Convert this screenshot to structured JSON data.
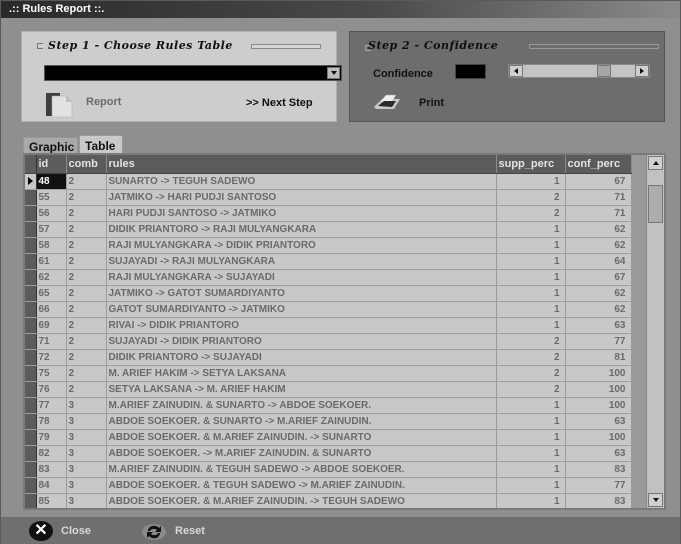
{
  "window": {
    "title": ".:: Rules Report ::."
  },
  "step1": {
    "heading": "Step 1 - Choose Rules Table",
    "dropdown_value": "",
    "report_label": "Report",
    "next_step_label": ">> Next Step"
  },
  "step2": {
    "heading": "Step 2 - Confidence",
    "confidence_label": "Confidence",
    "confidence_value": "",
    "slider_fraction": 0.75,
    "print_label": "Print"
  },
  "tabs": [
    {
      "label": "Graphic",
      "active": false
    },
    {
      "label": "Table",
      "active": true
    }
  ],
  "grid": {
    "columns": [
      "id",
      "comb",
      "rules",
      "supp_perc",
      "conf_perc"
    ],
    "selected_index": 0,
    "rows": [
      {
        "id": "48",
        "comb": "2",
        "rules": "SUNARTO -> TEGUH SADEWO",
        "supp_perc": "1",
        "conf_perc": "67"
      },
      {
        "id": "55",
        "comb": "2",
        "rules": "JATMIKO -> HARI PUDJI SANTOSO",
        "supp_perc": "2",
        "conf_perc": "71"
      },
      {
        "id": "56",
        "comb": "2",
        "rules": "HARI PUDJI SANTOSO -> JATMIKO",
        "supp_perc": "2",
        "conf_perc": "71"
      },
      {
        "id": "57",
        "comb": "2",
        "rules": "DIDIK PRIANTORO -> RAJI MULYANGKARA",
        "supp_perc": "1",
        "conf_perc": "62"
      },
      {
        "id": "58",
        "comb": "2",
        "rules": "RAJI MULYANGKARA -> DIDIK PRIANTORO",
        "supp_perc": "1",
        "conf_perc": "62"
      },
      {
        "id": "61",
        "comb": "2",
        "rules": "SUJAYADI -> RAJI MULYANGKARA",
        "supp_perc": "1",
        "conf_perc": "64"
      },
      {
        "id": "62",
        "comb": "2",
        "rules": "RAJI MULYANGKARA -> SUJAYADI",
        "supp_perc": "1",
        "conf_perc": "67"
      },
      {
        "id": "65",
        "comb": "2",
        "rules": "JATMIKO -> GATOT SUMARDIYANTO",
        "supp_perc": "1",
        "conf_perc": "62"
      },
      {
        "id": "66",
        "comb": "2",
        "rules": "GATOT SUMARDIYANTO -> JATMIKO",
        "supp_perc": "1",
        "conf_perc": "62"
      },
      {
        "id": "69",
        "comb": "2",
        "rules": "RIVAI -> DIDIK PRIANTORO",
        "supp_perc": "1",
        "conf_perc": "63"
      },
      {
        "id": "71",
        "comb": "2",
        "rules": "SUJAYADI -> DIDIK PRIANTORO",
        "supp_perc": "2",
        "conf_perc": "77"
      },
      {
        "id": "72",
        "comb": "2",
        "rules": "DIDIK PRIANTORO -> SUJAYADI",
        "supp_perc": "2",
        "conf_perc": "81"
      },
      {
        "id": "75",
        "comb": "2",
        "rules": "M. ARIEF HAKIM -> SETYA LAKSANA",
        "supp_perc": "2",
        "conf_perc": "100"
      },
      {
        "id": "76",
        "comb": "2",
        "rules": "SETYA LAKSANA -> M. ARIEF HAKIM",
        "supp_perc": "2",
        "conf_perc": "100"
      },
      {
        "id": "77",
        "comb": "3",
        "rules": "M.ARIEF ZAINUDIN. & SUNARTO -> ABDOE SOEKOER.",
        "supp_perc": "1",
        "conf_perc": "100"
      },
      {
        "id": "78",
        "comb": "3",
        "rules": "ABDOE SOEKOER. & SUNARTO -> M.ARIEF ZAINUDIN.",
        "supp_perc": "1",
        "conf_perc": "63"
      },
      {
        "id": "79",
        "comb": "3",
        "rules": "ABDOE SOEKOER. & M.ARIEF ZAINUDIN. -> SUNARTO",
        "supp_perc": "1",
        "conf_perc": "100"
      },
      {
        "id": "82",
        "comb": "3",
        "rules": "ABDOE SOEKOER. -> M.ARIEF ZAINUDIN. & SUNARTO",
        "supp_perc": "1",
        "conf_perc": "63"
      },
      {
        "id": "83",
        "comb": "3",
        "rules": "M.ARIEF ZAINUDIN. & TEGUH SADEWO -> ABDOE SOEKOER.",
        "supp_perc": "1",
        "conf_perc": "83"
      },
      {
        "id": "84",
        "comb": "3",
        "rules": "ABDOE SOEKOER. & TEGUH SADEWO -> M.ARIEF ZAINUDIN.",
        "supp_perc": "1",
        "conf_perc": "77"
      },
      {
        "id": "85",
        "comb": "3",
        "rules": "ABDOE SOEKOER. & M.ARIEF ZAINUDIN. -> TEGUH SADEWO",
        "supp_perc": "1",
        "conf_perc": "83"
      }
    ]
  },
  "footer": {
    "close_label": "Close",
    "reset_label": "Reset"
  },
  "icons": {
    "report": "report-document-icon",
    "print": "printer-icon",
    "close": "close-x-icon",
    "reset": "reset-refresh-icon"
  }
}
